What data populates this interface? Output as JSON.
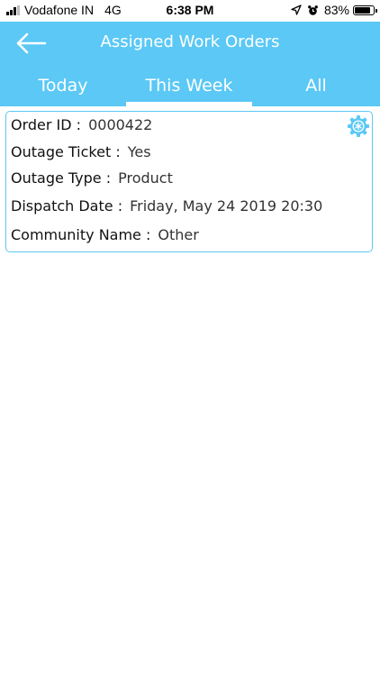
{
  "status_bar": {
    "carrier": "Vodafone IN",
    "network": "4G",
    "time": "6:38 PM",
    "battery_percent_label": "83%",
    "battery_level": 0.83,
    "signal_bars": 3
  },
  "header": {
    "title": "Assigned Work Orders",
    "back_icon": "arrow-left-icon",
    "background_color": "#5BC8F5"
  },
  "tabs": [
    {
      "label": "Today",
      "active": false
    },
    {
      "label": "This Week",
      "active": true
    },
    {
      "label": "All",
      "active": false
    }
  ],
  "work_orders": [
    {
      "order_id_label": "Order ID :",
      "order_id": "0000422",
      "outage_ticket_label": "Outage Ticket :",
      "outage_ticket": "Yes",
      "outage_type_label": "Outage Type :",
      "outage_type": "Product",
      "dispatch_date_label": "Dispatch Date :",
      "dispatch_date": "Friday, May 24 2019 20:30",
      "community_name_label": "Community Name :",
      "community_name": "Other",
      "action_icon": "settings-gear-icon"
    }
  ]
}
